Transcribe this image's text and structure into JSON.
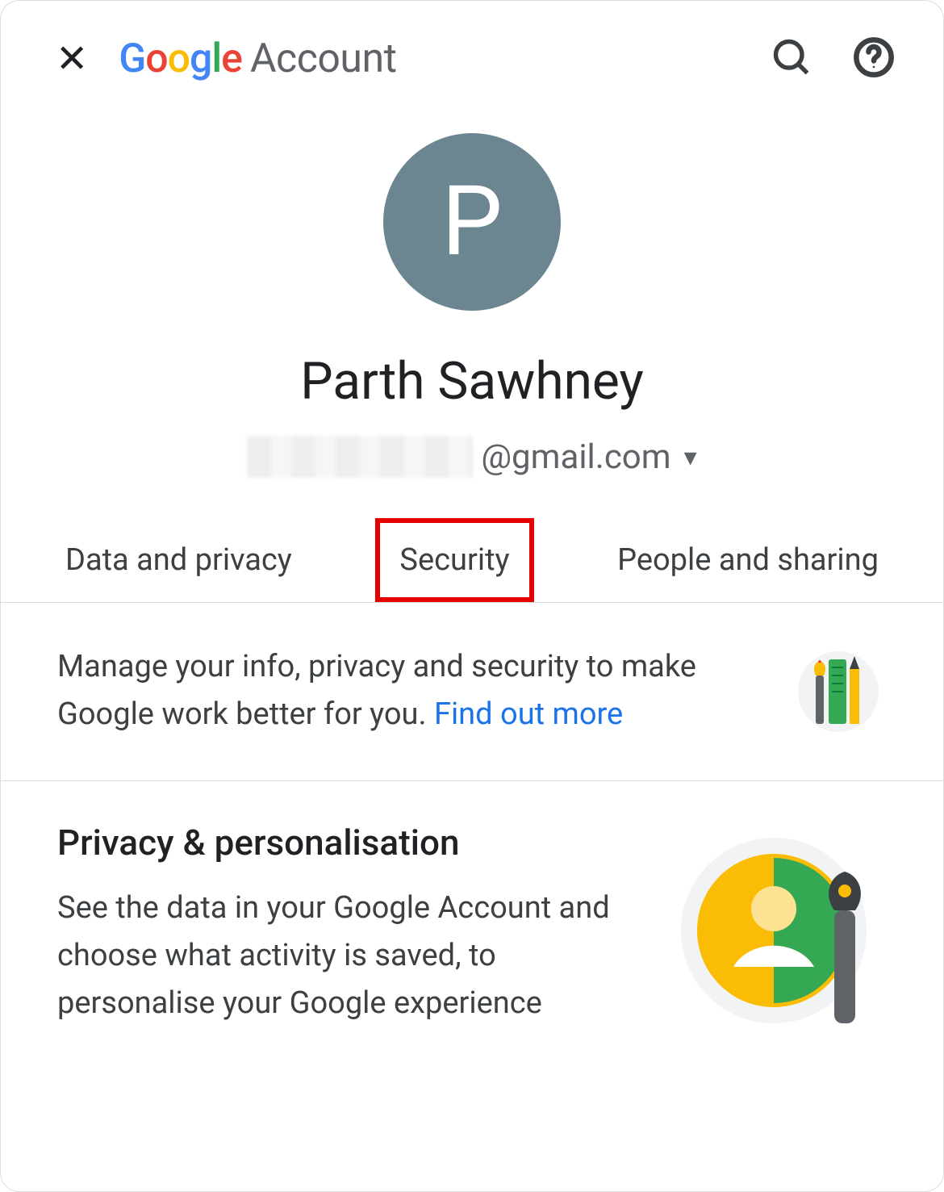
{
  "header": {
    "logo_account_word": "Account",
    "close_glyph": "✕"
  },
  "profile": {
    "avatar_initial": "P",
    "display_name": "Parth Sawhney",
    "email_domain": "@gmail.com"
  },
  "tabs": {
    "items": [
      {
        "label": "Data and privacy"
      },
      {
        "label": "Security"
      },
      {
        "label": "People and sharing"
      }
    ],
    "highlighted_index": 1
  },
  "intro": {
    "text": "Manage your info, privacy and security to make Google work better for you. ",
    "link_text": "Find out more"
  },
  "privacy_section": {
    "title": "Privacy & personalisation",
    "desc": "See the data in your Google Account and choose what activity is saved, to personalise your Google experience"
  },
  "colors": {
    "google_blue": "#4285F4",
    "google_red": "#EA4335",
    "google_yellow": "#FBBC05",
    "google_green": "#34A853",
    "link_blue": "#1a73e8",
    "avatar_bg": "#6c8691",
    "highlight_red": "#e60000"
  }
}
